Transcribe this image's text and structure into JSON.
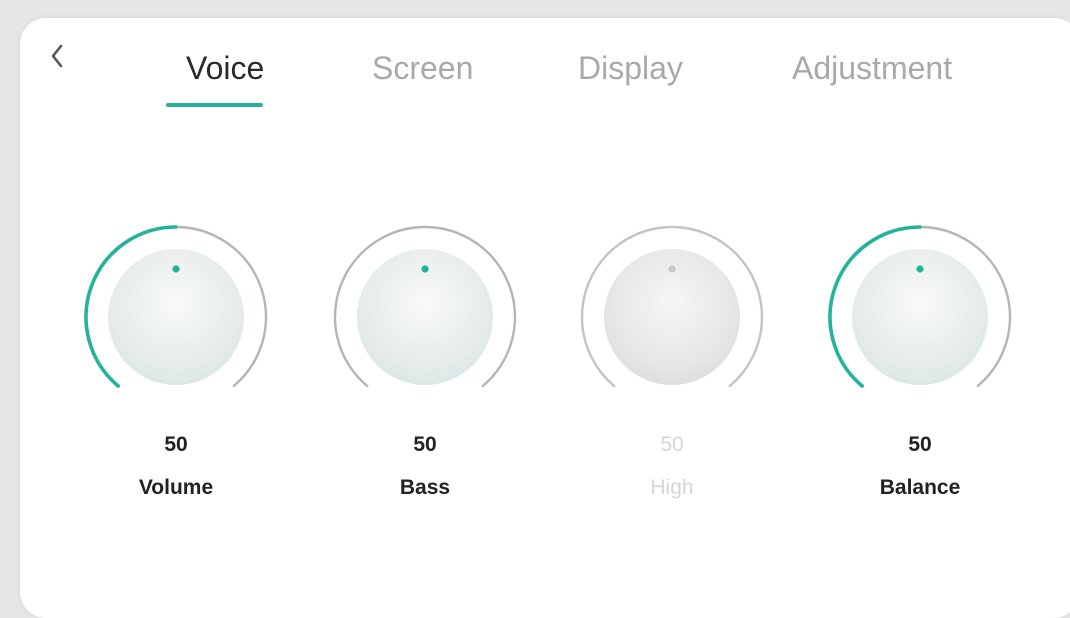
{
  "tabs": [
    {
      "label": "Voice",
      "active": true
    },
    {
      "label": "Screen",
      "active": false
    },
    {
      "label": "Display",
      "active": false
    },
    {
      "label": "Adjustment",
      "active": false
    }
  ],
  "knobs": [
    {
      "value": "50",
      "label": "Volume",
      "enabled": true,
      "level": 0.5
    },
    {
      "value": "50",
      "label": "Bass",
      "enabled": true,
      "level": 0
    },
    {
      "value": "50",
      "label": "High",
      "enabled": false,
      "level": 0
    },
    {
      "value": "50",
      "label": "Balance",
      "enabled": true,
      "level": 0.5
    }
  ],
  "colors": {
    "accent": "#22b39a",
    "track": "#b5b5b5",
    "disabled_track": "#c4c4c4",
    "active_text": "#2a2a2a",
    "inactive_text": "#a9a9a9"
  },
  "icons": {
    "back": "chevron-left-icon"
  }
}
